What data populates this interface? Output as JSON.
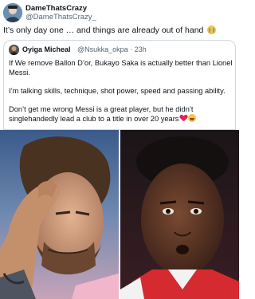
{
  "post": {
    "author_name": "DameThatsCrazy",
    "author_handle": "@DameThatsCrazy_",
    "text": "It’s only day one … and things are already out of hand",
    "emoji_icon": "crying-laughing-face"
  },
  "quoted_post": {
    "author_name": "Oyiga Micheal",
    "author_handle": "@Nsukka_okpa",
    "time": "23h",
    "paragraph_1": "If We remove Ballon D’or, Bukayo Saka is actually better than Lionel Messi.",
    "paragraph_2": "I’m talking skills, technique, shot power, speed and passing ability.",
    "paragraph_3": "Don’t get me wrong Messi is a great player, but he didn’t singlehandedly lead a club to a title in over 20 years",
    "trailing_icons": [
      "red-heart",
      "laughing-face"
    ]
  },
  "media": {
    "left_photo": "messi-photo",
    "right_photo": "saka-photo"
  },
  "colors": {
    "text": "#0f1419",
    "secondary": "#536471",
    "border": "#cfd9de",
    "heart": "#e0245e"
  }
}
